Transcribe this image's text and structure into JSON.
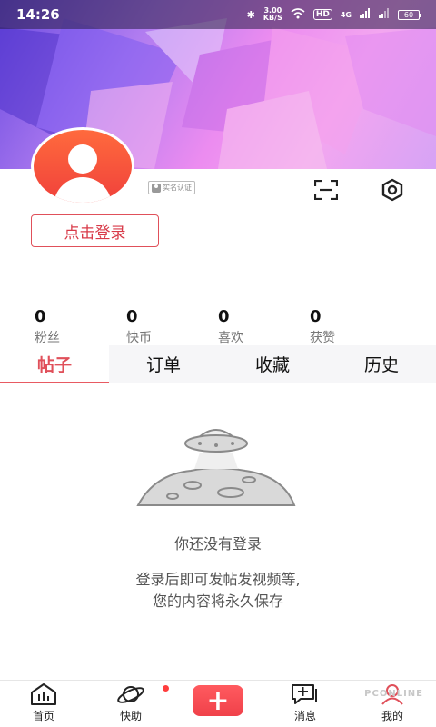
{
  "statusbar": {
    "time": "14:26",
    "net_speed_value": "3.00",
    "net_speed_unit": "KB/S",
    "hd_badge": "HD",
    "signal_label": "4G",
    "battery": "60"
  },
  "profile": {
    "realname_badge": "实名认证",
    "login_button": "点击登录"
  },
  "stats": [
    {
      "value": "0",
      "label": "粉丝"
    },
    {
      "value": "0",
      "label": "快币"
    },
    {
      "value": "0",
      "label": "喜欢"
    },
    {
      "value": "0",
      "label": "获赞"
    }
  ],
  "tabs": [
    {
      "label": "帖子",
      "active": true
    },
    {
      "label": "订单",
      "active": false
    },
    {
      "label": "收藏",
      "active": false
    },
    {
      "label": "历史",
      "active": false
    }
  ],
  "empty_state": {
    "title": "你还没有登录",
    "desc_line1": "登录后即可发帖发视频等,",
    "desc_line2": "您的内容将永久保存"
  },
  "bottom_nav": [
    {
      "label": "首页",
      "icon": "home-icon"
    },
    {
      "label": "快助",
      "icon": "planet-icon"
    },
    {
      "label": "",
      "icon": "plus-icon",
      "text": "+"
    },
    {
      "label": "消息",
      "icon": "message-icon"
    },
    {
      "label": "我的",
      "icon": "profile-icon"
    }
  ],
  "watermark": "PCONLINE",
  "colors": {
    "accent": "#e0505a",
    "avatar": "#f0413b"
  }
}
